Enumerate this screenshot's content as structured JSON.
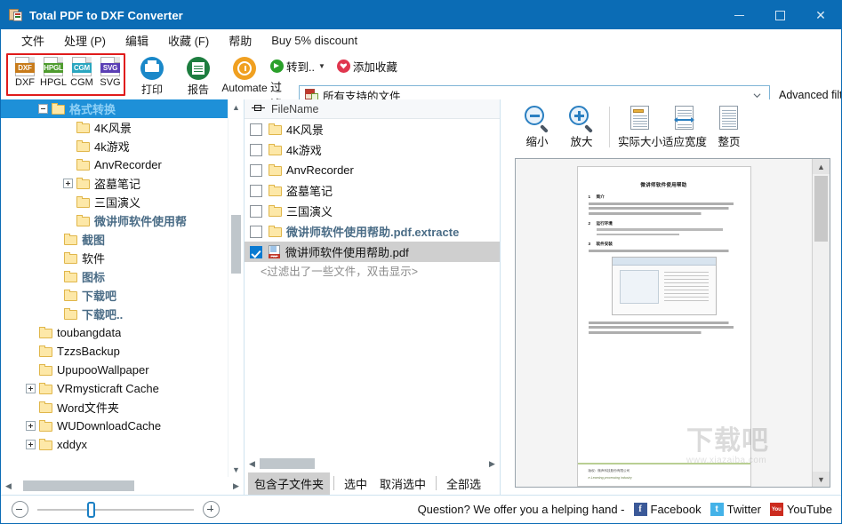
{
  "window": {
    "title": "Total PDF to DXF Converter",
    "icon": "app-document-icon",
    "minimize": "minimize",
    "maximize": "maximize",
    "close": "close",
    "titlebar_color": "#0b6cb5"
  },
  "menu": {
    "items": [
      {
        "label": "文件",
        "name": "menu-file"
      },
      {
        "label": "处理 (P)",
        "name": "menu-process"
      },
      {
        "label": "编辑",
        "name": "menu-edit"
      },
      {
        "label": "收藏 (F)",
        "name": "menu-favorites"
      },
      {
        "label": "帮助",
        "name": "menu-help"
      },
      {
        "label": "Buy 5% discount",
        "name": "menu-buy-discount"
      }
    ]
  },
  "toolbar": {
    "highlight_color": "#e01b1b",
    "formats": [
      {
        "label": "DXF",
        "tag": "DXF",
        "color": "#c87b1a"
      },
      {
        "label": "HPGL",
        "tag": "HPGL",
        "color": "#4f9c2f"
      },
      {
        "label": "CGM",
        "tag": "CGM",
        "color": "#2aa6c0"
      },
      {
        "label": "SVG",
        "tag": "SVG",
        "color": "#5b3fb5"
      }
    ],
    "print_label": "打印",
    "report_label": "报告",
    "automate_label": "Automate",
    "goto_label": "转到..",
    "addfav_label": "添加收藏",
    "filter_label": "过滤：",
    "filter_value": "所有支持的文件",
    "advanced_filter_label": "Advanced filter"
  },
  "tree": {
    "nodes": [
      {
        "label": "格式转换",
        "indent": 3,
        "expander": "minus",
        "selected": true,
        "style": "cjk-bold"
      },
      {
        "label": "4K风景",
        "indent": 5,
        "expander": "none",
        "selected": false,
        "style": "plain"
      },
      {
        "label": "4k游戏",
        "indent": 5,
        "expander": "none",
        "selected": false,
        "style": "plain"
      },
      {
        "label": "AnvRecorder",
        "indent": 5,
        "expander": "none",
        "selected": false,
        "style": "plain"
      },
      {
        "label": "盗墓笔记",
        "indent": 5,
        "expander": "plus",
        "selected": false,
        "style": "plain"
      },
      {
        "label": "三国演义",
        "indent": 5,
        "expander": "none",
        "selected": false,
        "style": "plain"
      },
      {
        "label": "微讲师软件使用帮",
        "indent": 5,
        "expander": "none",
        "selected": false,
        "style": "blue"
      },
      {
        "label": "截图",
        "indent": 4,
        "expander": "none",
        "selected": false,
        "style": "blue"
      },
      {
        "label": "软件",
        "indent": 4,
        "expander": "none",
        "selected": false,
        "style": "plain"
      },
      {
        "label": "图标",
        "indent": 4,
        "expander": "none",
        "selected": false,
        "style": "blue"
      },
      {
        "label": "下载吧",
        "indent": 4,
        "expander": "none",
        "selected": false,
        "style": "blue"
      },
      {
        "label": "下载吧..",
        "indent": 4,
        "expander": "none",
        "selected": false,
        "style": "blue"
      },
      {
        "label": "toubangdata",
        "indent": 2,
        "expander": "none",
        "selected": false,
        "style": "plain"
      },
      {
        "label": "TzzsBackup",
        "indent": 2,
        "expander": "none",
        "selected": false,
        "style": "plain"
      },
      {
        "label": "UpupooWallpaper",
        "indent": 2,
        "expander": "none",
        "selected": false,
        "style": "plain"
      },
      {
        "label": "VRmysticraft Cache",
        "indent": 2,
        "expander": "plus",
        "selected": false,
        "style": "plain"
      },
      {
        "label": "Word文件夹",
        "indent": 2,
        "expander": "none",
        "selected": false,
        "style": "plain"
      },
      {
        "label": "WUDownloadCache",
        "indent": 2,
        "expander": "plus",
        "selected": false,
        "style": "plain"
      },
      {
        "label": "xddyx",
        "indent": 2,
        "expander": "plus",
        "selected": false,
        "style": "plain"
      }
    ]
  },
  "filelist": {
    "column_header": "FileName",
    "rows": [
      {
        "name": "4K风景",
        "checked": false,
        "icon": "folder-icon",
        "style": "plain",
        "selected": false
      },
      {
        "name": "4k游戏",
        "checked": false,
        "icon": "folder-icon",
        "style": "plain",
        "selected": false
      },
      {
        "name": "AnvRecorder",
        "checked": false,
        "icon": "folder-icon",
        "style": "plain",
        "selected": false
      },
      {
        "name": "盗墓笔记",
        "checked": false,
        "icon": "folder-icon",
        "style": "plain",
        "selected": false
      },
      {
        "name": "三国演义",
        "checked": false,
        "icon": "folder-icon",
        "style": "plain",
        "selected": false
      },
      {
        "name": "微讲师软件使用帮助.pdf.extracte",
        "checked": false,
        "icon": "folder-icon",
        "style": "blue",
        "selected": false
      },
      {
        "name": "微讲师软件使用帮助.pdf",
        "checked": true,
        "icon": "pdf-icon",
        "style": "plain",
        "selected": true
      }
    ],
    "filter_note": "<过滤出了一些文件，双击显示>",
    "buttons": [
      {
        "label": "包含子文件夹",
        "name": "include-subfolders-button",
        "active": true
      },
      {
        "label": "选中",
        "name": "select-button",
        "active": false
      },
      {
        "label": "取消选中",
        "name": "deselect-button",
        "active": false
      },
      {
        "label": "全部选",
        "name": "select-all-button",
        "active": false
      }
    ]
  },
  "preview": {
    "buttons": [
      {
        "label": "缩小",
        "name": "zoom-out-button",
        "icon": "zoom-out-icon"
      },
      {
        "label": "放大",
        "name": "zoom-in-button",
        "icon": "zoom-in-icon"
      },
      {
        "label": "实际大小",
        "name": "actual-size-button",
        "icon": "actual-size-icon"
      },
      {
        "label": "适应宽度",
        "name": "fit-width-button",
        "icon": "fit-width-icon"
      },
      {
        "label": "整页",
        "name": "whole-page-button",
        "icon": "whole-page-icon"
      }
    ],
    "document": {
      "title": "微讲师软件使用帮助",
      "sections": [
        {
          "num": "1",
          "heading": "简介"
        },
        {
          "num": "2",
          "heading": "运行环境"
        },
        {
          "num": "3",
          "heading": "软件安装"
        }
      ],
      "footer_cn": "版权：微声科技股份有限公司",
      "footer_en": "e-Learning processing industry"
    }
  },
  "status": {
    "help_text": "Question? We offer you a helping hand -",
    "social": [
      {
        "label": "Facebook",
        "name": "facebook-link",
        "glyph": "f",
        "color": "#3b5998"
      },
      {
        "label": "Twitter",
        "name": "twitter-link",
        "glyph": "t",
        "color": "#44b2e8"
      },
      {
        "label": "YouTube",
        "name": "youtube-link",
        "glyph": "You",
        "color": "#cc2b1f"
      }
    ]
  },
  "watermark": {
    "big": "下载吧",
    "small": "www.xiazaiba.com"
  }
}
